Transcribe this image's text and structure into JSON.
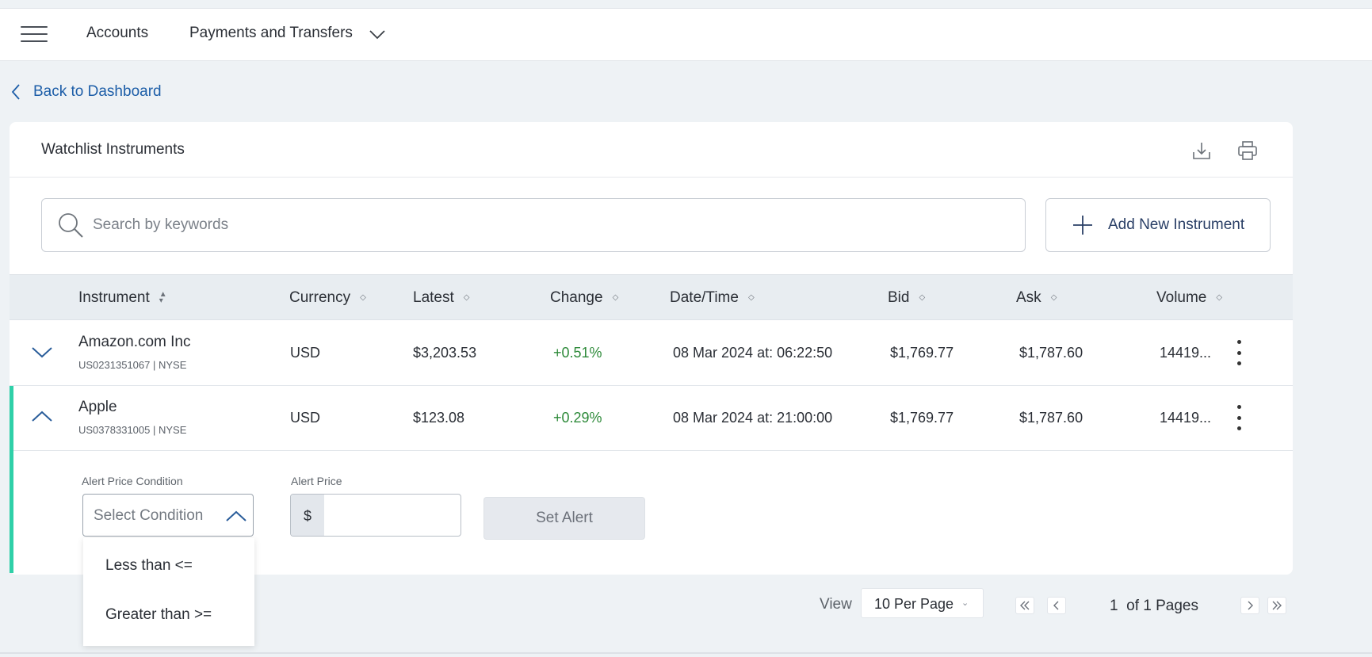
{
  "nav": {
    "items": [
      "Accounts",
      "Payments and Transfers"
    ]
  },
  "back_link": "Back to Dashboard",
  "card": {
    "title": "Watchlist Instruments"
  },
  "search": {
    "placeholder": "Search by keywords"
  },
  "add_button": "Add New Instrument",
  "table": {
    "columns": [
      "Instrument",
      "Currency",
      "Latest",
      "Change",
      "Date/Time",
      "Bid",
      "Ask",
      "Volume"
    ],
    "rows": [
      {
        "name": "Amazon.com Inc",
        "sub": "US0231351067 | NYSE",
        "currency": "USD",
        "latest": "$3,203.53",
        "change": "+0.51%",
        "datetime": "08 Mar 2024 at: 06:22:50",
        "bid": "$1,769.77",
        "ask": "$1,787.60",
        "volume": "14419...",
        "expanded": false
      },
      {
        "name": "Apple",
        "sub": "US0378331005 | NYSE",
        "currency": "USD",
        "latest": "$123.08",
        "change": "+0.29%",
        "datetime": "08 Mar 2024 at: 21:00:00",
        "bid": "$1,769.77",
        "ask": "$1,787.60",
        "volume": "14419...",
        "expanded": true
      }
    ]
  },
  "alert": {
    "condition_label": "Alert Price Condition",
    "condition_placeholder": "Select Condition",
    "price_label": "Alert Price",
    "currency_symbol": "$",
    "price_value": "",
    "set_button": "Set Alert",
    "condition_options": [
      "Less than <=",
      "Greater than >="
    ]
  },
  "pagination": {
    "view_label": "View",
    "per_page": "10 Per Page",
    "current_page": "1",
    "of_pages": "of 1 Pages"
  },
  "colors": {
    "accent_teal": "#2fd0a8",
    "link_blue": "#1d5ea8",
    "positive_green": "#2e8a3a"
  }
}
